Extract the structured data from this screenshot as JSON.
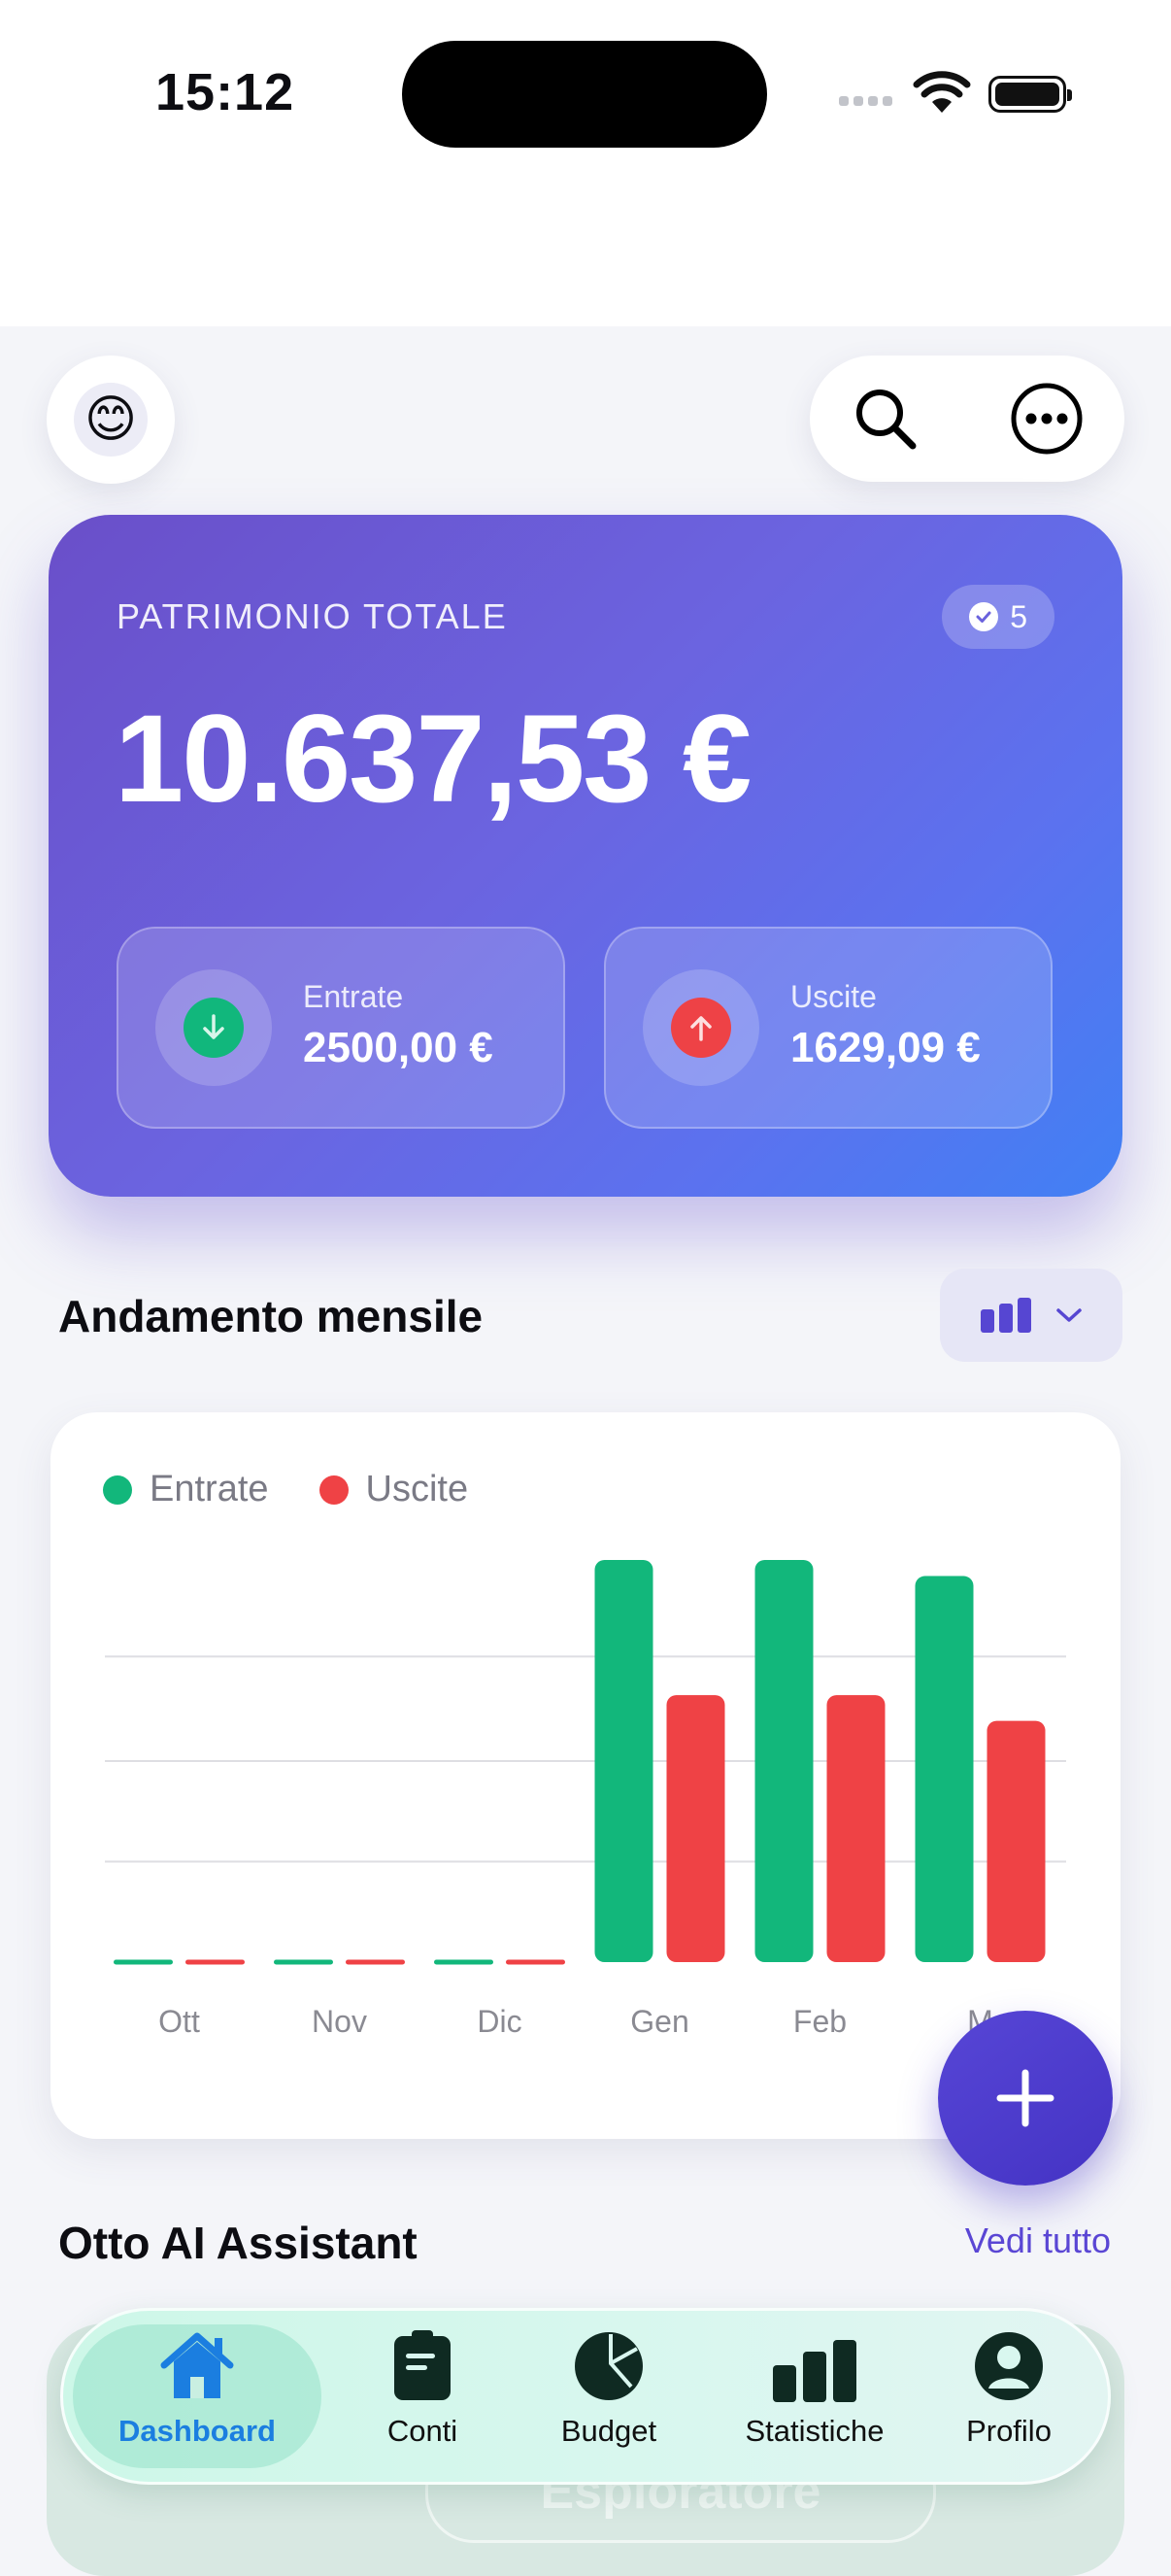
{
  "status_bar": {
    "time": "15:12"
  },
  "header": {
    "avatar_emoji": "😊",
    "search_icon": "search-icon",
    "more_icon": "ellipsis-circle-icon"
  },
  "balance_card": {
    "label": "PATRIMONIO TOTALE",
    "badge_count": "5",
    "total": "10.637,53 €",
    "income": {
      "label": "Entrate",
      "value": "2500,00 €"
    },
    "expense": {
      "label": "Uscite",
      "value": "1629,09 €"
    },
    "colors": {
      "income": "#11b77c",
      "expense": "#ee4246"
    }
  },
  "trend_section": {
    "title": "Andamento mensile",
    "selector_icon": "bar-chart-icon"
  },
  "chart_data": {
    "type": "bar",
    "categories": [
      "Ott",
      "Nov",
      "Dic",
      "Gen",
      "Feb",
      "M"
    ],
    "series": [
      {
        "name": "Entrate",
        "color": "#12b77b",
        "values": [
          0,
          0,
          0,
          2500,
          2500,
          2400
        ]
      },
      {
        "name": "Uscite",
        "color": "#ef4245",
        "values": [
          0,
          0,
          0,
          1660,
          1660,
          1500
        ]
      }
    ],
    "ylim": [
      0,
      2500
    ],
    "grid": true,
    "legend": "top-left"
  },
  "assistant_section": {
    "title": "Otto AI Assistant",
    "link": "Vedi tutto",
    "ghost_card_text": "Esploratore"
  },
  "tab_bar": {
    "items": [
      {
        "label": "Dashboard",
        "icon": "house-icon",
        "active": true
      },
      {
        "label": "Conti",
        "icon": "document-icon",
        "active": false
      },
      {
        "label": "Budget",
        "icon": "pie-chart-icon",
        "active": false
      },
      {
        "label": "Statistiche",
        "icon": "bar-chart-icon",
        "active": false
      },
      {
        "label": "Profilo",
        "icon": "person-circle-icon",
        "active": false
      }
    ]
  }
}
